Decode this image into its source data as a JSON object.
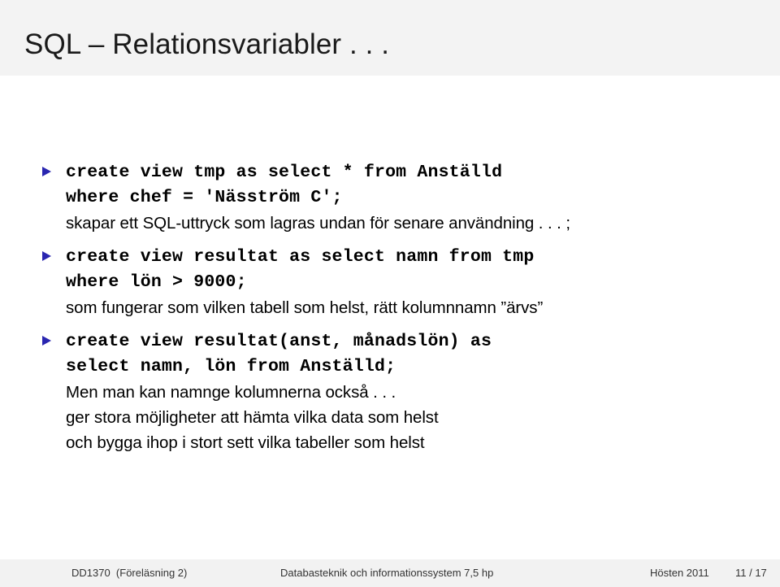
{
  "header": {
    "title": "SQL – Relationsvariabler . . ."
  },
  "slide": {
    "bullet_marker_color": "#2a26b0",
    "bullets": [
      {
        "marker": "triangle-right-icon",
        "lines": [
          {
            "kind": "code",
            "text": "create view tmp as select * from Anställd"
          },
          {
            "kind": "code",
            "text": "where chef = 'Näsström C';"
          },
          {
            "kind": "prose",
            "text": "skapar ett SQL-uttryck som lagras undan för senare användning . . . ;"
          }
        ]
      },
      {
        "marker": "triangle-right-icon",
        "lines": [
          {
            "kind": "code",
            "text": "create view resultat as select namn from tmp"
          },
          {
            "kind": "code",
            "text": "where lön > 9000;"
          },
          {
            "kind": "prose",
            "text": "som fungerar som vilken tabell som helst, rätt kolumnnamn ”ärvs”"
          }
        ]
      },
      {
        "marker": "triangle-right-icon",
        "lines": [
          {
            "kind": "code",
            "text": "create view resultat(anst, månadslön) as"
          },
          {
            "kind": "code",
            "text": "select namn, lön from Anställd;"
          },
          {
            "kind": "prose",
            "text": "Men man kan namnge kolumnerna också . . ."
          },
          {
            "kind": "prose",
            "text": "ger stora möjligheter att hämta vilka data som helst"
          },
          {
            "kind": "prose",
            "text": "och bygga ihop i stort sett vilka tabeller som helst"
          }
        ]
      }
    ]
  },
  "footer": {
    "course": "DD1370  (Föreläsning 2)",
    "center": "Databasteknik och informationssystem 7,5 hp",
    "term": "Hösten 2011",
    "page": "11 / 17"
  }
}
